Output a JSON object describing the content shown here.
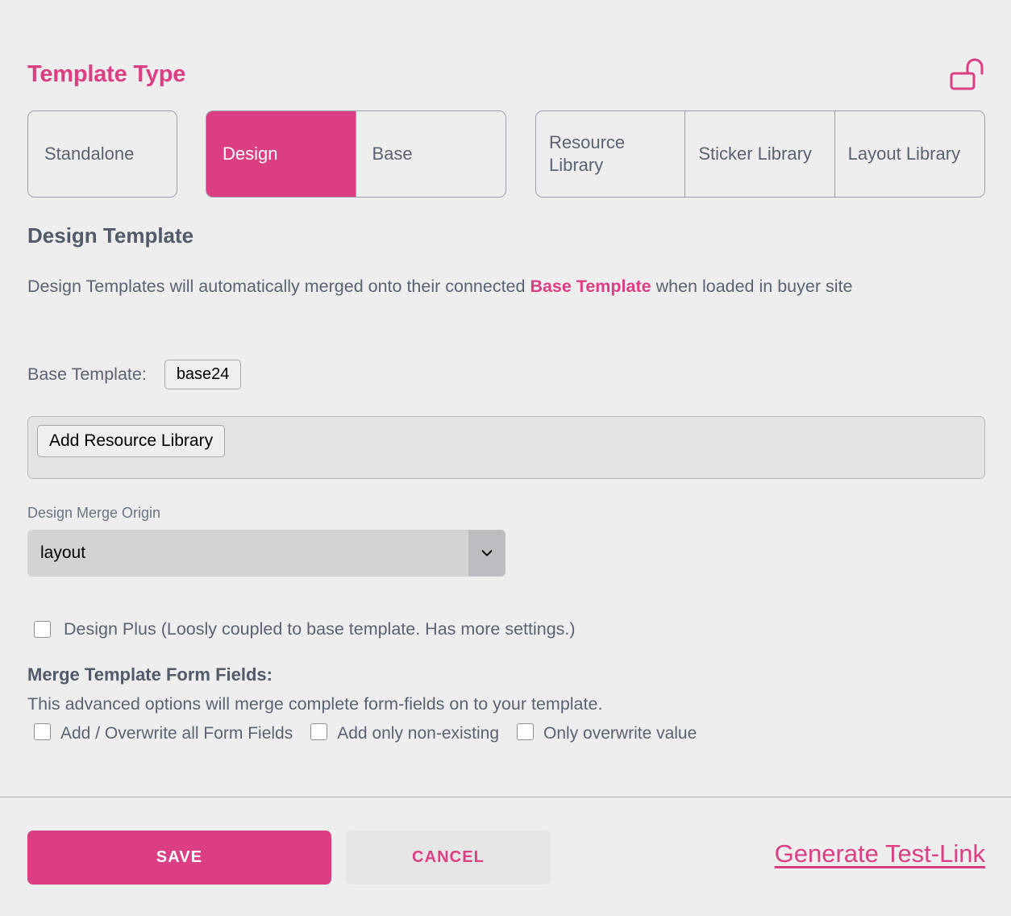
{
  "header": {
    "title": "Template Type",
    "lock_icon": "unlocked-padlock-icon",
    "accent_color": "#db3e83"
  },
  "template_type": {
    "groups": [
      {
        "name": "standalone-group",
        "options": [
          {
            "label": "Standalone",
            "active": false
          }
        ]
      },
      {
        "name": "design-base-group",
        "options": [
          {
            "label": "Design",
            "active": true
          },
          {
            "label": "Base",
            "active": false
          }
        ]
      },
      {
        "name": "library-group",
        "options": [
          {
            "label": "Resource Library",
            "active": false
          },
          {
            "label": "Sticker Library",
            "active": false
          },
          {
            "label": "Layout Library",
            "active": false
          }
        ]
      }
    ]
  },
  "design_template": {
    "heading": "Design Template",
    "description_part1": "Design Templates will automatically merged onto their connected ",
    "description_highlight": "Base Template",
    "description_part2": " when loaded in buyer site",
    "base_template_label": "Base Template:",
    "base_template_value": "base24",
    "add_resource_library_label": "Add Resource Library"
  },
  "merge_origin": {
    "label": "Design Merge Origin",
    "value": "layout",
    "chevron_icon": "chevron-down-icon"
  },
  "design_plus": {
    "label": "Design Plus (Loosly coupled to base template. Has more settings.)",
    "checked": false
  },
  "merge_form_fields": {
    "title": "Merge Template Form Fields:",
    "description": "This advanced options will merge complete form-fields on to your template.",
    "options": [
      {
        "label": "Add / Overwrite all Form Fields",
        "checked": false
      },
      {
        "label": "Add only non-existing",
        "checked": false
      },
      {
        "label": "Only overwrite value",
        "checked": false
      }
    ]
  },
  "footer": {
    "save_label": "SAVE",
    "cancel_label": "CANCEL",
    "test_link_label": "Generate Test-Link"
  }
}
